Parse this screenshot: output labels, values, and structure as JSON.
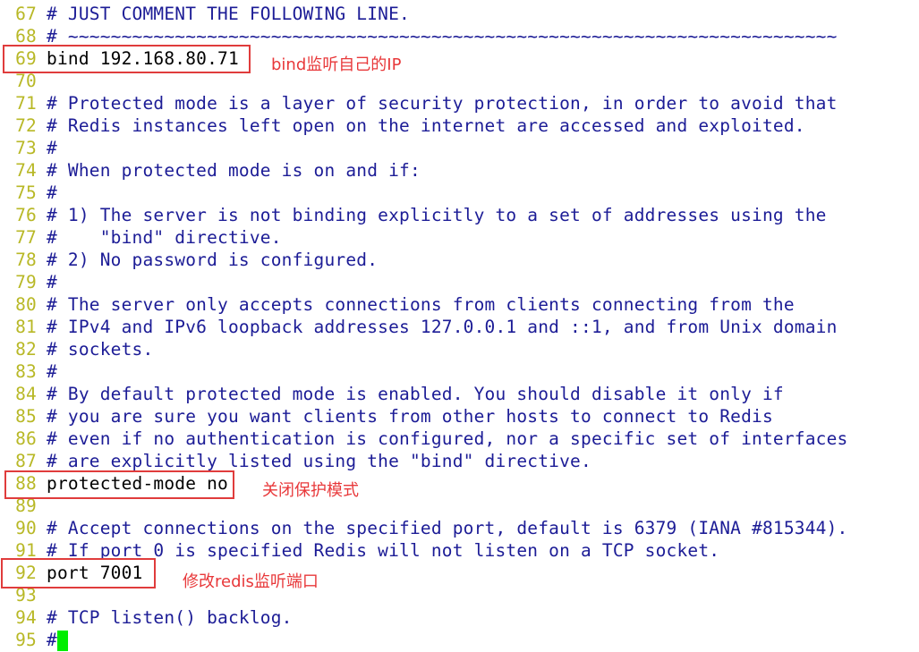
{
  "editor": {
    "lines": [
      {
        "num": "67",
        "text": "# JUST COMMENT THE FOLLOWING LINE.",
        "kind": "comment"
      },
      {
        "num": "68",
        "text": "# ~~~~~~~~~~~~~~~~~~~~~~~~~~~~~~~~~~~~~~~~~~~~~~~~~~~~~~~~~~~~~~~~~~~~~~~~",
        "kind": "comment"
      },
      {
        "num": "69",
        "text": "bind 192.168.80.71",
        "kind": "code"
      },
      {
        "num": "70",
        "text": "",
        "kind": "code"
      },
      {
        "num": "71",
        "text": "# Protected mode is a layer of security protection, in order to avoid that",
        "kind": "comment"
      },
      {
        "num": "72",
        "text": "# Redis instances left open on the internet are accessed and exploited.",
        "kind": "comment"
      },
      {
        "num": "73",
        "text": "#",
        "kind": "comment"
      },
      {
        "num": "74",
        "text": "# When protected mode is on and if:",
        "kind": "comment"
      },
      {
        "num": "75",
        "text": "#",
        "kind": "comment"
      },
      {
        "num": "76",
        "text": "# 1) The server is not binding explicitly to a set of addresses using the",
        "kind": "comment"
      },
      {
        "num": "77",
        "text": "#    \"bind\" directive.",
        "kind": "comment"
      },
      {
        "num": "78",
        "text": "# 2) No password is configured.",
        "kind": "comment"
      },
      {
        "num": "79",
        "text": "#",
        "kind": "comment"
      },
      {
        "num": "80",
        "text": "# The server only accepts connections from clients connecting from the",
        "kind": "comment"
      },
      {
        "num": "81",
        "text": "# IPv4 and IPv6 loopback addresses 127.0.0.1 and ::1, and from Unix domain",
        "kind": "comment"
      },
      {
        "num": "82",
        "text": "# sockets.",
        "kind": "comment"
      },
      {
        "num": "83",
        "text": "#",
        "kind": "comment"
      },
      {
        "num": "84",
        "text": "# By default protected mode is enabled. You should disable it only if",
        "kind": "comment"
      },
      {
        "num": "85",
        "text": "# you are sure you want clients from other hosts to connect to Redis",
        "kind": "comment"
      },
      {
        "num": "86",
        "text": "# even if no authentication is configured, nor a specific set of interfaces",
        "kind": "comment"
      },
      {
        "num": "87",
        "text": "# are explicitly listed using the \"bind\" directive.",
        "kind": "comment"
      },
      {
        "num": "88",
        "text": "protected-mode no",
        "kind": "code"
      },
      {
        "num": "89",
        "text": "",
        "kind": "code"
      },
      {
        "num": "90",
        "text": "# Accept connections on the specified port, default is 6379 (IANA #815344).",
        "kind": "comment"
      },
      {
        "num": "91",
        "text": "# If port 0 is specified Redis will not listen on a TCP socket.",
        "kind": "comment"
      },
      {
        "num": "92",
        "text": "port 7001",
        "kind": "code"
      },
      {
        "num": "93",
        "text": "",
        "kind": "code"
      },
      {
        "num": "94",
        "text": "# TCP listen() backlog.",
        "kind": "comment"
      },
      {
        "num": "95",
        "text": "#",
        "kind": "comment",
        "cursor": true
      }
    ]
  },
  "annotations": {
    "bind": "bind监听自己的IP",
    "protected_mode": "关闭保护模式",
    "port": "修改redis监听端口"
  },
  "colors": {
    "line_number": "#b8b826",
    "comment": "#1c1c96",
    "code": "#000000",
    "cursor": "#00ee00",
    "annotation": "#e8383a"
  }
}
